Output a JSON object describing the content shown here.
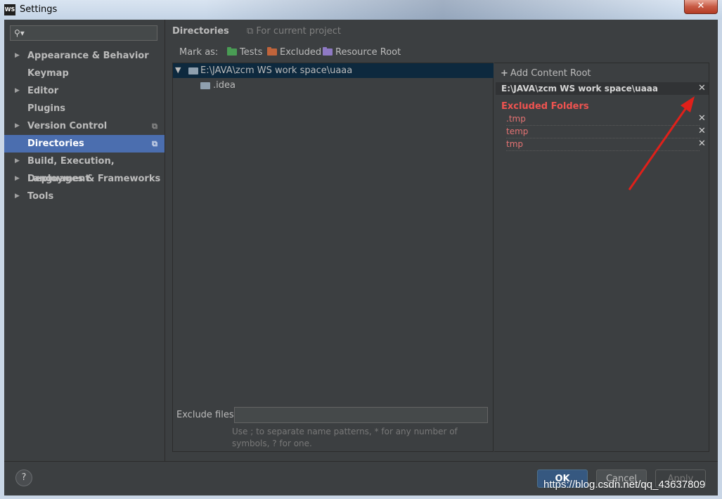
{
  "window": {
    "app_icon": "WS",
    "title": "Settings",
    "close_label": "✕"
  },
  "search": {
    "placeholder": ""
  },
  "sidebar": {
    "items": [
      {
        "label": "Appearance & Behavior",
        "expandable": true
      },
      {
        "label": "Keymap",
        "expandable": false
      },
      {
        "label": "Editor",
        "expandable": true
      },
      {
        "label": "Plugins",
        "expandable": false
      },
      {
        "label": "Version Control",
        "expandable": true,
        "project_icon": true
      },
      {
        "label": "Directories",
        "expandable": false,
        "selected": true,
        "project_icon": true
      },
      {
        "label": "Build, Execution, Deployment",
        "expandable": true
      },
      {
        "label": "Languages & Frameworks",
        "expandable": true
      },
      {
        "label": "Tools",
        "expandable": true
      }
    ]
  },
  "main": {
    "title": "Directories",
    "scope": "For current project",
    "mark_as_label": "Mark as:",
    "mark_buttons": [
      {
        "label": "Tests",
        "color": "#499c54"
      },
      {
        "label": "Excluded",
        "color": "#c0643b"
      },
      {
        "label": "Resource Root",
        "color": "#8e79c4"
      }
    ],
    "tree": [
      {
        "label": "E:\\JAVA\\zcm WS work space\\uaaa",
        "expanded": true
      },
      {
        "label": ".idea"
      }
    ],
    "exclude_files_label": "Exclude files:",
    "exclude_files_value": "",
    "hint": "Use ; to separate name patterns, * for any number of symbols, ? for one."
  },
  "right": {
    "add_content_root": "Add Content Root",
    "root_path": "E:\\JAVA\\zcm WS work space\\uaaa",
    "excluded_title": "Excluded Folders",
    "excluded": [
      ".tmp",
      "temp",
      "tmp"
    ]
  },
  "footer": {
    "help": "?",
    "ok": "OK",
    "cancel": "Cancel",
    "apply": "Apply"
  },
  "watermark": "https://blog.csdn.net/qq_43637809",
  "colors": {
    "accent": "#4b6eaf",
    "excluded_red": "#ef5350",
    "annotation_arrow": "#e0201a"
  }
}
